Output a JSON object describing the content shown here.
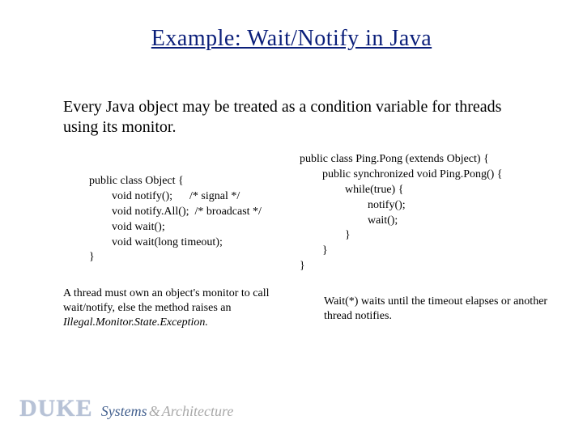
{
  "title": "Example: Wait/Notify in Java",
  "intro": "Every Java object may be treated as a condition variable for threads using its monitor.",
  "code_left": "public class Object {\n        void notify();      /* signal */\n        void notify.All();  /* broadcast */\n        void wait();\n        void wait(long timeout);\n}",
  "code_right": "public class Ping.Pong (extends Object) {\n        public synchronized void Ping.Pong() {\n                while(true) {\n                        notify();\n                        wait();\n                }\n        }\n}",
  "note_left_prefix": "A thread must own an object's monitor to call wait/notify, else the method raises an ",
  "note_left_italic": "Illegal.Monitor.State.Exception.",
  "note_right": "Wait(*) waits until the timeout elapses or another thread notifies.",
  "footer": {
    "duke": "DUKE",
    "systems": "Systems",
    "amp": "&",
    "architecture": "Architecture"
  }
}
